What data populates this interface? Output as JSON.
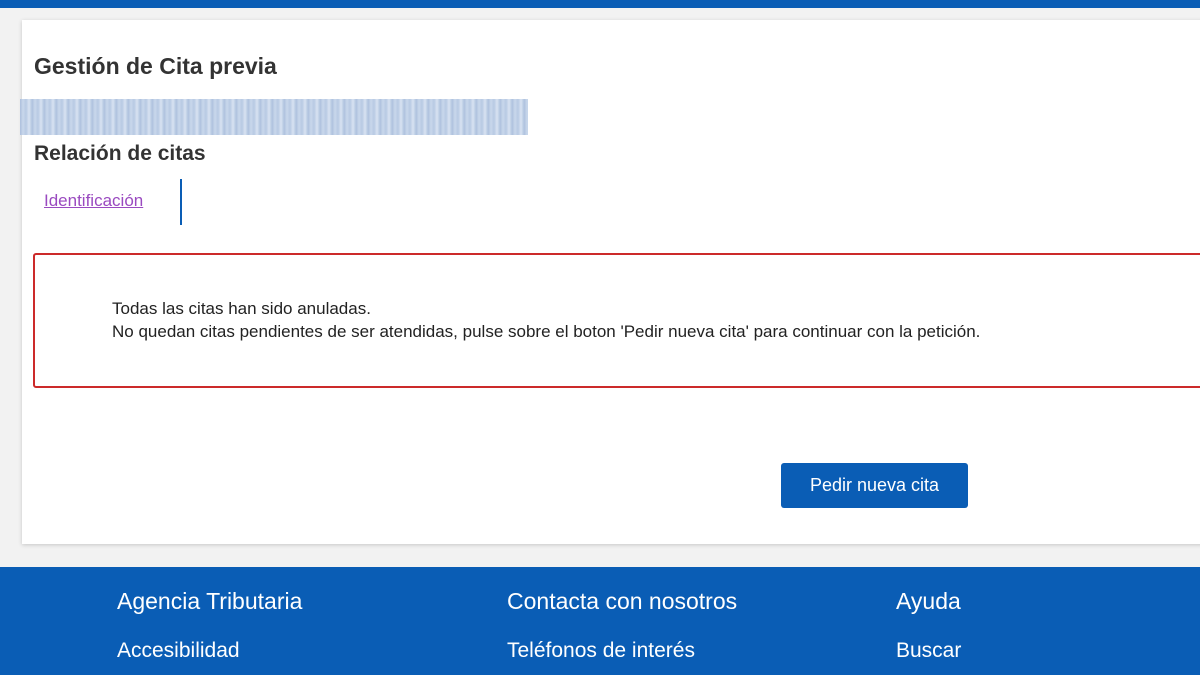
{
  "page": {
    "title": "Gestión de Cita previa",
    "section_title": "Relación de citas"
  },
  "tabs": {
    "identificacion": "Identificación"
  },
  "alert": {
    "line1": "Todas las citas han sido anuladas.",
    "line2": "No quedan citas pendientes de ser atendidas, pulse sobre el boton 'Pedir nueva cita' para continuar con la petición."
  },
  "actions": {
    "new_appointment": "Pedir nueva cita"
  },
  "footer": {
    "columns": [
      {
        "heading": "Agencia Tributaria",
        "link": "Accesibilidad"
      },
      {
        "heading": "Contacta con nosotros",
        "link": "Teléfonos de interés"
      },
      {
        "heading": "Ayuda",
        "link": "Buscar"
      }
    ]
  },
  "colors": {
    "brand_blue": "#0a5db5",
    "alert_border": "#cc2a2a",
    "visited_link": "#9a4ac0"
  }
}
